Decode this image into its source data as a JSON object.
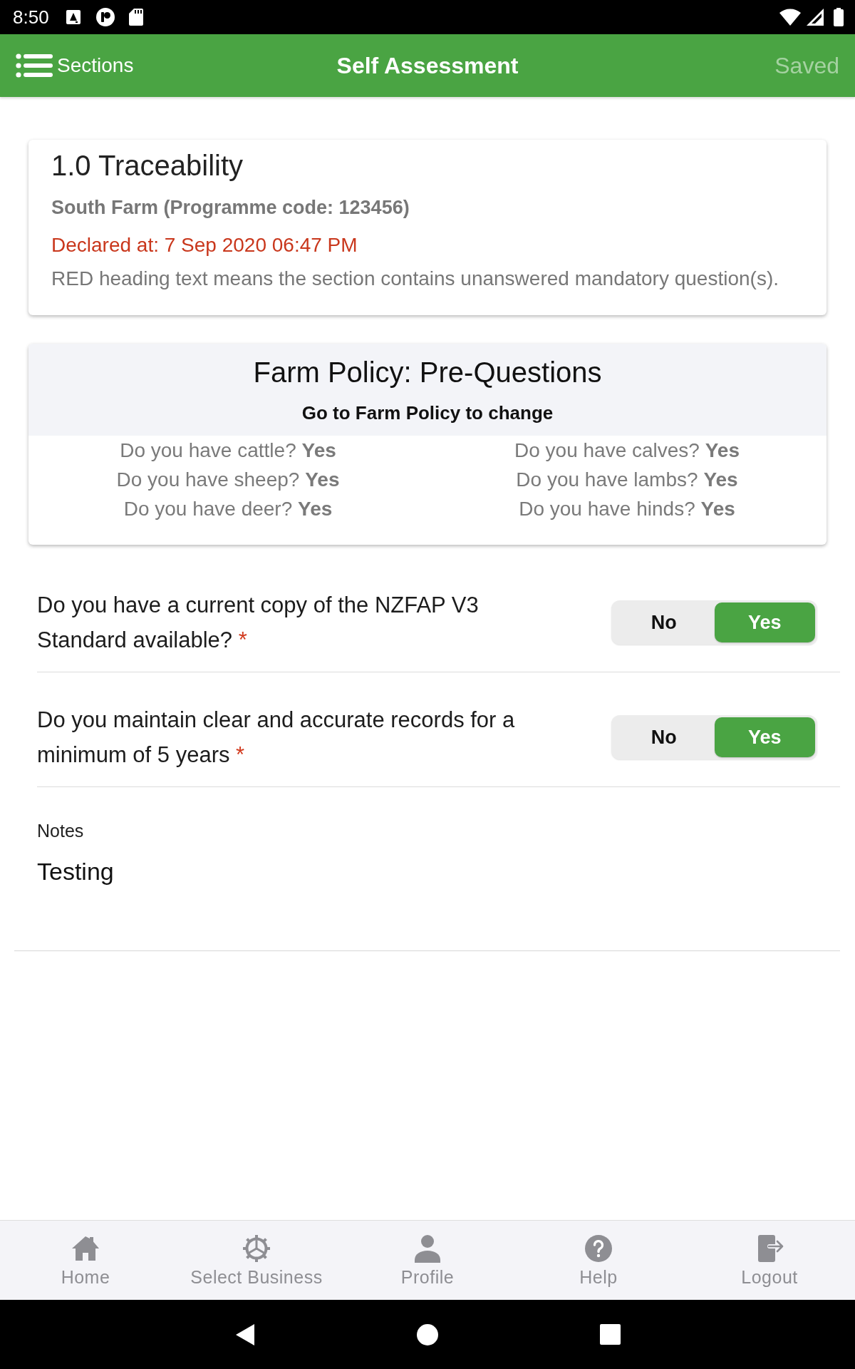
{
  "status_bar": {
    "time": "8:50"
  },
  "header": {
    "sections_label": "Sections",
    "title": "Self Assessment",
    "save_label": "Saved",
    "save_disabled": true
  },
  "section_card": {
    "title": "1.0 Traceability",
    "farm": "South Farm (Programme code: 123456)",
    "declared": "Declared at: 7 Sep 2020 06:47 PM",
    "note": "RED heading text means the section contains unanswered mandatory question(s)."
  },
  "pre_questions": {
    "title": "Farm Policy: Pre-Questions",
    "subtitle": "Go to Farm Policy to change",
    "items": [
      "Do you have cattle? **Yes**",
      "Do you have calves? **Yes**",
      "Do you have sheep? **Yes**",
      "Do you have lambs? **Yes**",
      "Do you have deer? **Yes**",
      "Do you have hinds? **Yes**"
    ]
  },
  "questions": [
    {
      "text": "Do you have a current copy of the NZFAP V3 Standard available?",
      "required_mark": "*",
      "options": [
        {
          "label": "No",
          "selected": false
        },
        {
          "label": "Yes",
          "selected": true
        }
      ]
    },
    {
      "text": "Do you maintain clear and accurate records for a minimum of 5 years",
      "required_mark": "*",
      "options": [
        {
          "label": "No",
          "selected": false
        },
        {
          "label": "Yes",
          "selected": true
        }
      ]
    }
  ],
  "notes": {
    "label": "Notes",
    "value": "Testing"
  },
  "bottom_nav": {
    "items": [
      {
        "label": "Home"
      },
      {
        "label": "Select Business"
      },
      {
        "label": "Profile"
      },
      {
        "label": "Help"
      },
      {
        "label": "Logout"
      }
    ]
  }
}
